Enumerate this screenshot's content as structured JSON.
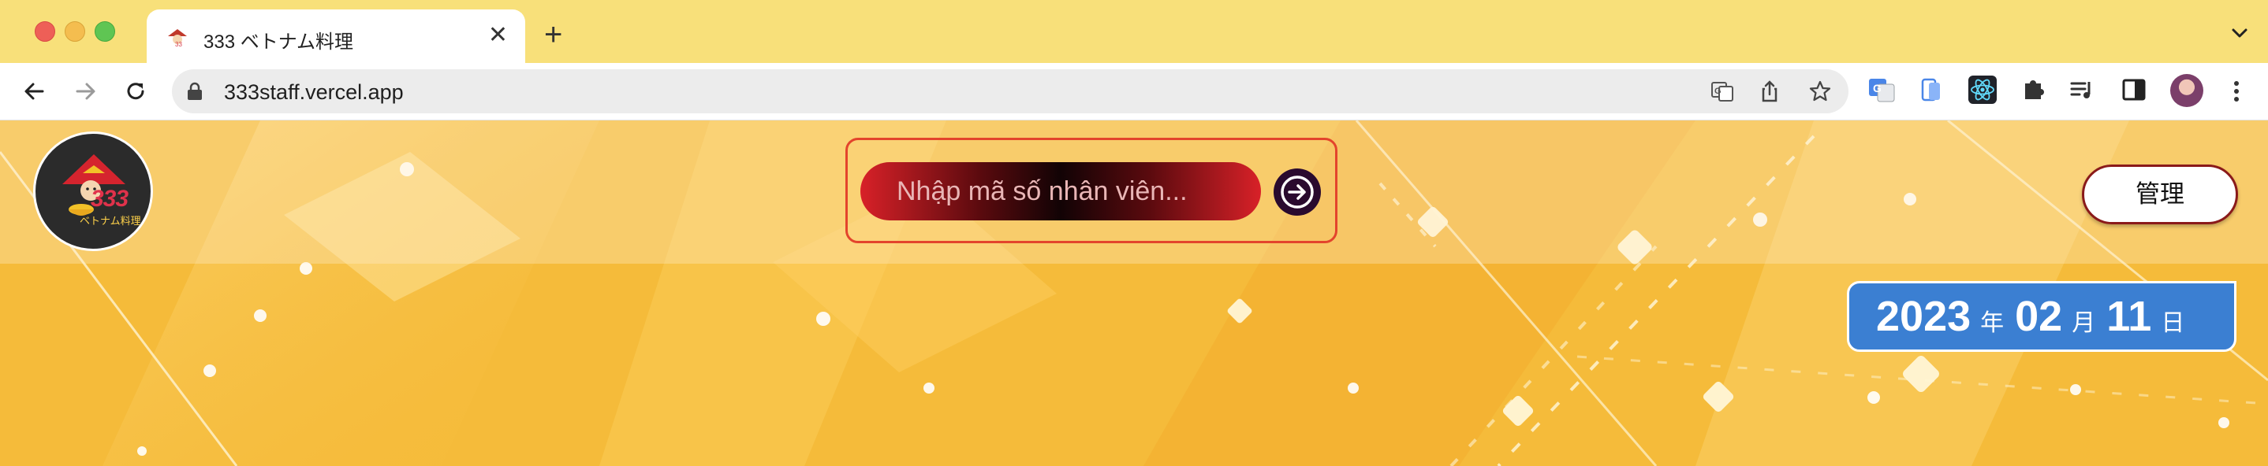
{
  "browser": {
    "tab_title": "333 ベトナム料理",
    "new_tab_symbol": "+",
    "close_symbol": "✕",
    "url": "333staff.vercel.app"
  },
  "page": {
    "logo_number": "333",
    "logo_subtitle": "ベトナム料理",
    "search": {
      "placeholder": "Nhập mã số nhân viên..."
    },
    "admin_button_label": "管理",
    "date": {
      "year": "2023",
      "year_unit": "年",
      "month": "02",
      "month_unit": "月",
      "day": "11",
      "day_unit": "日"
    }
  },
  "colors": {
    "tab_strip": "#f8e07a",
    "page_bg": "#f4b634",
    "search_border": "#e3442c",
    "date_badge": "#3b7fd2",
    "go_button": "#2a0a2e"
  }
}
